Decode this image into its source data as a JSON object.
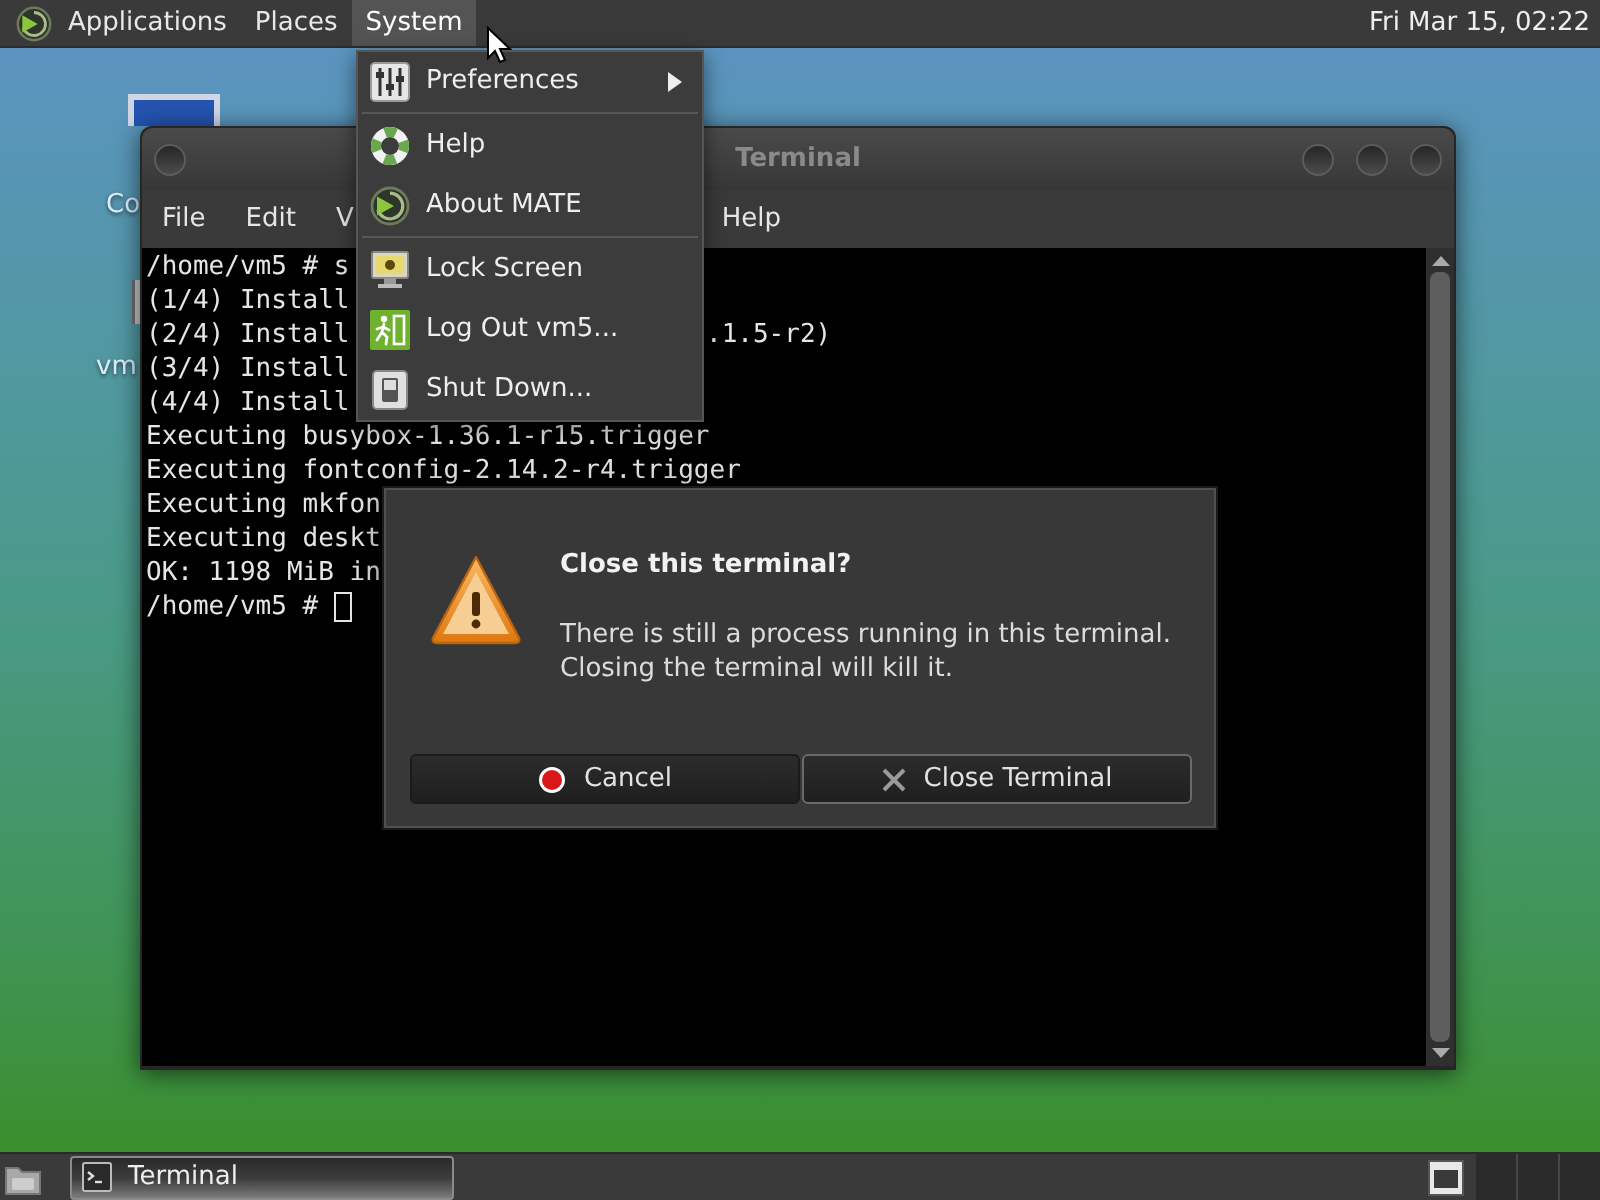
{
  "top_panel": {
    "menus": [
      {
        "label": "Applications",
        "selected": false
      },
      {
        "label": "Places",
        "selected": false
      },
      {
        "label": "System",
        "selected": true
      }
    ],
    "clock": "Fri Mar 15, 02:22"
  },
  "system_menu": {
    "sections": [
      {
        "items": [
          {
            "label": "Preferences",
            "submenu": true
          }
        ]
      },
      {
        "items": [
          {
            "label": "Help",
            "submenu": false
          },
          {
            "label": "About MATE",
            "submenu": false
          }
        ]
      },
      {
        "items": [
          {
            "label": "Lock Screen",
            "submenu": false
          },
          {
            "label": "Log Out vm5...",
            "submenu": false
          },
          {
            "label": "Shut Down...",
            "submenu": false
          }
        ]
      }
    ]
  },
  "desktop_icons": [
    {
      "label": "Co"
    },
    {
      "label": "vm"
    }
  ],
  "terminal_window": {
    "title": "Terminal",
    "menu_bar": [
      "File",
      "Edit",
      "V",
      "Help"
    ],
    "lines": [
      {
        "segments": [
          "/home/vm5 # s"
        ],
        "cursor": false
      },
      {
        "segments": [
          "(1/4) Install"
        ],
        "cursor": false
      },
      {
        "segments": [
          "(2/4) Install",
          ".1.5-r2)"
        ],
        "cursor": false
      },
      {
        "segments": [
          "(3/4) Install"
        ],
        "cursor": false
      },
      {
        "segments": [
          "(4/4) Install"
        ],
        "cursor": false
      },
      {
        "segments": [
          "Executing busybox-1.36.1-r15.trigger"
        ],
        "cursor": false
      },
      {
        "segments": [
          "Executing fontconfig-2.14.2-r4.trigger"
        ],
        "cursor": false
      },
      {
        "segments": [
          "Executing mkfon"
        ],
        "cursor": false
      },
      {
        "segments": [
          "Executing deskt"
        ],
        "cursor": false
      },
      {
        "segments": [
          "OK: 1198 MiB in"
        ],
        "cursor": false
      },
      {
        "segments": [
          "/home/vm5 # "
        ],
        "cursor": true
      }
    ]
  },
  "dialog": {
    "title": "Close this terminal?",
    "message": "There is still a process running in this terminal.\nClosing the terminal will kill it.",
    "buttons": [
      {
        "label": "Cancel",
        "kind": "cancel",
        "focused": false
      },
      {
        "label": "Close Terminal",
        "kind": "close",
        "focused": true
      }
    ]
  },
  "bottom_panel": {
    "tasks": [
      {
        "label": "Terminal",
        "selected": true
      }
    ]
  }
}
